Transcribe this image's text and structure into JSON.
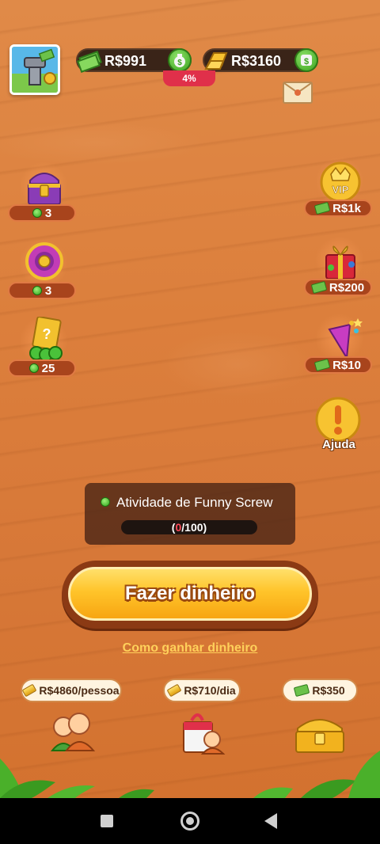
{
  "top_bar": {
    "cash_balance": "R$991",
    "gold_balance": "R$3160",
    "progress_percent": "4%"
  },
  "left_items": [
    {
      "name": "treasure-chest",
      "count": "3"
    },
    {
      "name": "lucky-wheel",
      "count": "3"
    },
    {
      "name": "scratch-cards",
      "count": "25"
    }
  ],
  "right_items": [
    {
      "name": "vip",
      "value": "R$1k"
    },
    {
      "name": "gift-bag",
      "value": "R$200"
    },
    {
      "name": "party-popper",
      "value": "R$10"
    }
  ],
  "help": {
    "label": "Ajuda"
  },
  "activity": {
    "title": "Atividade de Funny Screw",
    "current": "0",
    "total": "/100)",
    "open": "("
  },
  "main_button": {
    "label": "Fazer dinheiro"
  },
  "how_to_link": {
    "label": "Como ganhar dinheiro"
  },
  "rewards": [
    {
      "label": "R$4860/pessoa"
    },
    {
      "label": "R$710/dia"
    },
    {
      "label": "R$350"
    }
  ],
  "colors": {
    "background": "#dc7f3c",
    "button": "#ffc42a",
    "link": "#ffd05a",
    "progress_current": "#ff4a5a"
  }
}
